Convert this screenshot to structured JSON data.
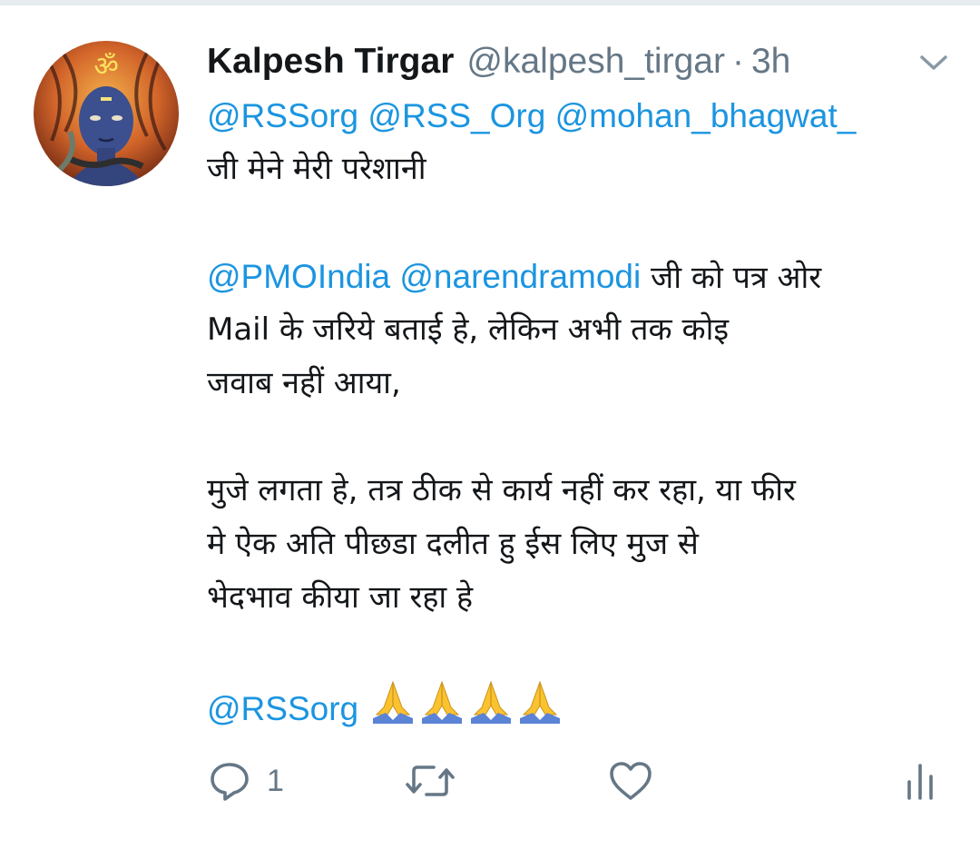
{
  "tweet": {
    "author_name": "Kalpesh Tirgar",
    "handle": "@kalpesh_tirgar",
    "separator": "·",
    "time": "3h",
    "lines": [
      [
        {
          "type": "mention",
          "text": "@RSSorg @RSS_Org @mohan_bhagwat_"
        }
      ],
      [
        {
          "type": "text",
          "text": "जी मेने मेरी परेशानी"
        }
      ],
      [],
      [
        {
          "type": "mention",
          "text": "@PMOIndia @narendramodi"
        },
        {
          "type": "text",
          "text": " जी को पत्र ओर"
        }
      ],
      [
        {
          "type": "text",
          "text": "Mail के जरिये बताई हे, लेकिन अभी तक कोइ"
        }
      ],
      [
        {
          "type": "text",
          "text": "जवाब नहीं आया,"
        }
      ],
      [],
      [
        {
          "type": "text",
          "text": "मुजे लगता हे, तत्र ठीक से कार्य नहीं कर रहा, या फीर"
        }
      ],
      [
        {
          "type": "text",
          "text": "मे ऐेक अति पीछडा दलीत हु ईस लिए मुज से"
        }
      ],
      [
        {
          "type": "text",
          "text": "भेदभाव कीया जा रहा हे"
        }
      ],
      [],
      [
        {
          "type": "mention",
          "text": "@RSSorg"
        },
        {
          "type": "emoji",
          "count": 4,
          "name": "folded-hands-emoji"
        }
      ]
    ]
  },
  "actions": {
    "reply_count": "1",
    "icons": [
      "reply-icon",
      "retweet-icon",
      "like-icon",
      "analytics-icon"
    ]
  },
  "colors": {
    "accent": "#1b95e0",
    "secondary_text": "#657786",
    "primary_text": "#14171a",
    "divider": "#e6ecf0"
  }
}
